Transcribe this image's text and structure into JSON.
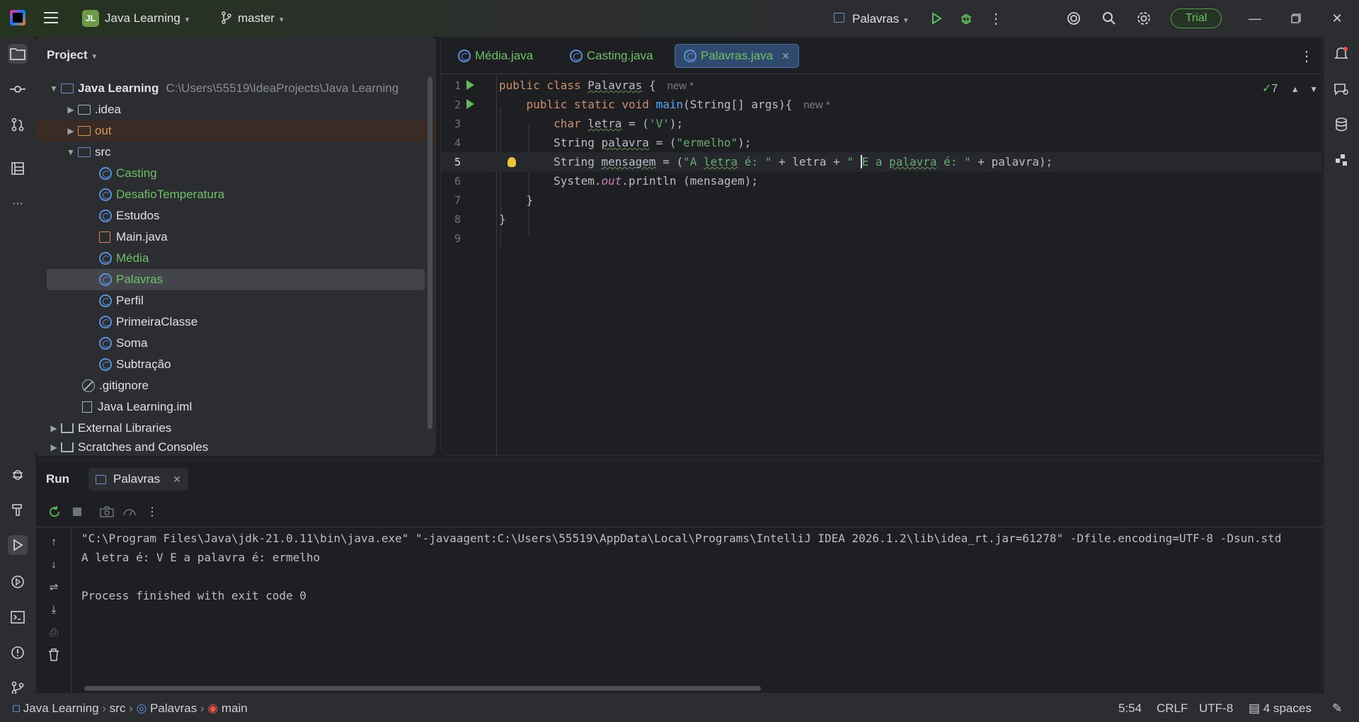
{
  "titlebar": {
    "project_initials": "JL",
    "project_name": "Java Learning",
    "branch": "master",
    "run_config": "Palavras",
    "trial_label": "Trial"
  },
  "project_panel": {
    "title": "Project",
    "root_name": "Java Learning",
    "root_path": "C:\\Users\\55519\\IdeaProjects\\Java Learning",
    "items": {
      "idea": ".idea",
      "out": "out",
      "src": "src",
      "casting": "Casting",
      "desafio": "DesafioTemperatura",
      "estudos": "Estudos",
      "main": "Main.java",
      "media": "Média",
      "palavras": "Palavras",
      "perfil": "Perfil",
      "primeira": "PrimeiraClasse",
      "soma": "Soma",
      "subtracao": "Subtração",
      "gitignore": ".gitignore",
      "iml": "Java Learning.iml",
      "external": "External Libraries",
      "scratches": "Scratches and Consoles"
    }
  },
  "editor": {
    "tabs": [
      "Média.java",
      "Casting.java",
      "Palavras.java"
    ],
    "active_tab": "Palavras.java",
    "inspections_count": "7",
    "line_numbers": [
      "1",
      "2",
      "3",
      "4",
      "5",
      "6",
      "7",
      "8",
      "9"
    ],
    "hint_new": "new *"
  },
  "run_panel": {
    "title": "Run",
    "tab": "Palavras",
    "console": [
      "\"C:\\Program Files\\Java\\jdk-21.0.11\\bin\\java.exe\" \"-javaagent:C:\\Users\\55519\\AppData\\Local\\Programs\\IntelliJ IDEA 2026.1.2\\lib\\idea_rt.jar=61278\" -Dfile.encoding=UTF-8 -Dsun.std",
      "A letra é: V E a palavra é: ermelho",
      "",
      "Process finished with exit code 0"
    ]
  },
  "statusbar": {
    "crumbs": [
      "Java Learning",
      "src",
      "Palavras",
      "main"
    ],
    "position": "5:54",
    "line_sep": "CRLF",
    "encoding": "UTF-8",
    "indent": "4 spaces"
  },
  "colors": {
    "accent": "#3574f0",
    "run_green": "#5fb85a",
    "trial_green": "#6fbf6a",
    "keyword": "#cf8e6d",
    "string": "#6aab73"
  }
}
